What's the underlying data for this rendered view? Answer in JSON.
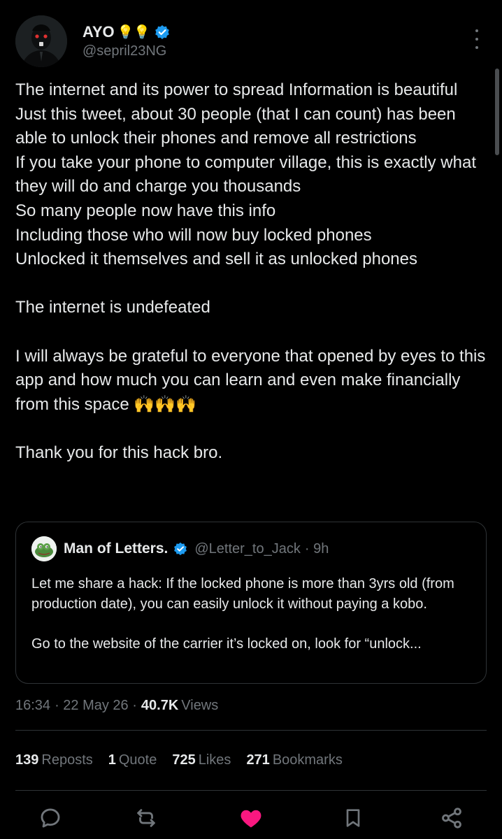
{
  "author": {
    "display_name": "AYO",
    "name_emoji": "💡💡",
    "handle": "@sepril23NG",
    "verified_color": "#1d9bf0"
  },
  "tweet": {
    "paragraphs": [
      "The internet and its power to spread Information is beautiful\nJust this tweet, about 30 people (that I can count) has been able to unlock their phones and remove all restrictions\nIf you take your phone to computer village, this is exactly what they will do and charge you thousands\nSo many people now have this info\nIncluding those who will now buy locked phones\nUnlocked it themselves and sell it as unlocked phones",
      "The internet is undefeated",
      "I will always be grateful to everyone that opened by eyes to this app and how much you can learn and even make financially from this space 🙌🙌🙌",
      "Thank you for this hack bro."
    ]
  },
  "quote": {
    "name": "Man of Letters.",
    "handle": "@Letter_to_Jack",
    "time": "· 9h",
    "text": "Let me share a hack: If the locked phone is more than 3yrs old (from production date), you can easily unlock it without paying a kobo.\n\nGo to the website of the carrier it’s locked on, look for “unlock..."
  },
  "meta": {
    "time": "16:34",
    "date": "· 22 May 26 ·",
    "views_count": "40.7K",
    "views_label": "Views"
  },
  "stats": {
    "reposts_count": "139",
    "reposts_label": "Reposts",
    "quotes_count": "1",
    "quotes_label": "Quote",
    "likes_count": "725",
    "likes_label": "Likes",
    "bookmarks_count": "271",
    "bookmarks_label": "Bookmarks"
  },
  "actions": {
    "icons": [
      "reply-icon",
      "repost-icon",
      "like-icon",
      "bookmark-icon",
      "share-icon"
    ],
    "like_color": "#f91880"
  },
  "colors": {
    "background": "#000000",
    "text": "#e7e9ea",
    "secondary": "#71767b",
    "border": "#2f3336"
  }
}
